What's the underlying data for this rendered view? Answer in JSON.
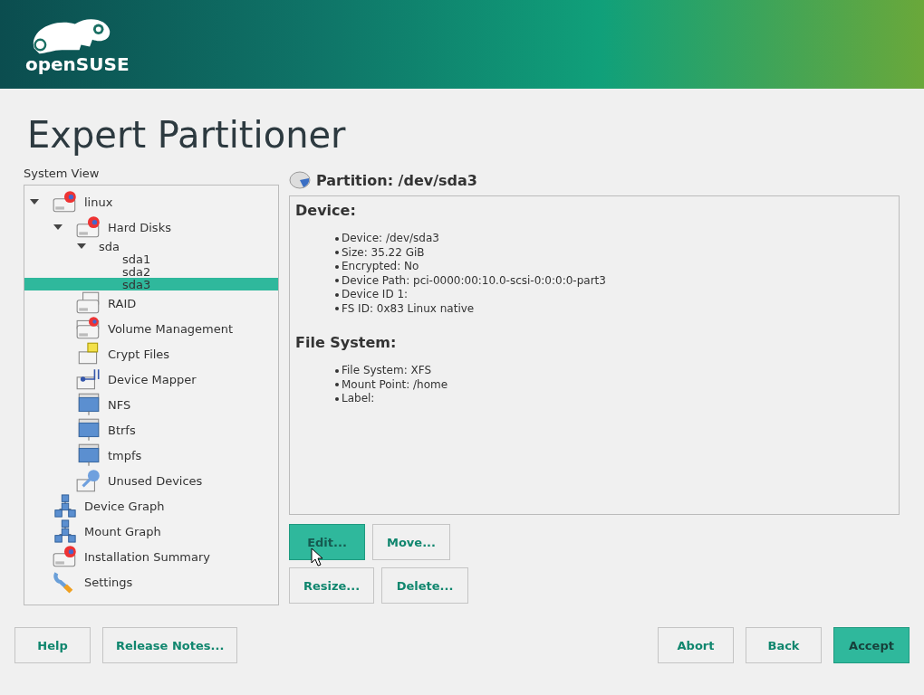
{
  "header": {
    "logo_text": "openSUSE"
  },
  "title": "Expert Partitioner",
  "system_view": {
    "label": "System View",
    "tree": [
      {
        "label": "linux",
        "kind": "disk",
        "expanded": true,
        "selected": false,
        "children": [
          {
            "label": "Hard Disks",
            "kind": "disk",
            "expanded": true,
            "selected": false,
            "children": [
              {
                "label": "sda",
                "kind": "plain",
                "expanded": true,
                "selected": false,
                "children": [
                  {
                    "label": "sda1",
                    "kind": "plain",
                    "selected": false
                  },
                  {
                    "label": "sda2",
                    "kind": "plain",
                    "selected": false
                  },
                  {
                    "label": "sda3",
                    "kind": "plain",
                    "selected": true
                  }
                ]
              }
            ]
          },
          {
            "label": "RAID",
            "kind": "raid",
            "selected": false
          },
          {
            "label": "Volume Management",
            "kind": "lvm",
            "selected": false
          },
          {
            "label": "Crypt Files",
            "kind": "crypt",
            "selected": false
          },
          {
            "label": "Device Mapper",
            "kind": "mapper",
            "selected": false
          },
          {
            "label": "NFS",
            "kind": "folder",
            "selected": false
          },
          {
            "label": "Btrfs",
            "kind": "folder",
            "selected": false
          },
          {
            "label": "tmpfs",
            "kind": "folder",
            "selected": false
          },
          {
            "label": "Unused Devices",
            "kind": "unused",
            "selected": false
          }
        ]
      },
      {
        "label": "Device Graph",
        "kind": "graph",
        "selected": false
      },
      {
        "label": "Mount Graph",
        "kind": "graph",
        "selected": false
      },
      {
        "label": "Installation Summary",
        "kind": "disk",
        "selected": false
      },
      {
        "label": "Settings",
        "kind": "settings",
        "selected": false
      }
    ]
  },
  "details": {
    "heading": "Partition: /dev/sda3",
    "sections": [
      {
        "title": "Device:",
        "items": [
          "Device: /dev/sda3",
          "Size: 35.22 GiB",
          "Encrypted: No",
          "Device Path: pci-0000:00:10.0-scsi-0:0:0:0-part3",
          "Device ID 1:",
          "FS ID: 0x83 Linux native"
        ]
      },
      {
        "title": "File System:",
        "items": [
          "File System: XFS",
          "Mount Point: /home",
          "Label:"
        ]
      }
    ]
  },
  "actions": [
    {
      "label": "Edit...",
      "focused": true
    },
    {
      "label": "Move...",
      "focused": false
    },
    {
      "label": "Resize...",
      "focused": false
    },
    {
      "label": "Delete...",
      "focused": false
    }
  ],
  "footer": {
    "left": [
      {
        "label": "Help",
        "primary": false
      },
      {
        "label": "Release Notes...",
        "primary": false
      }
    ],
    "right": [
      {
        "label": "Abort",
        "primary": false
      },
      {
        "label": "Back",
        "primary": false
      },
      {
        "label": "Accept",
        "primary": true
      }
    ]
  }
}
